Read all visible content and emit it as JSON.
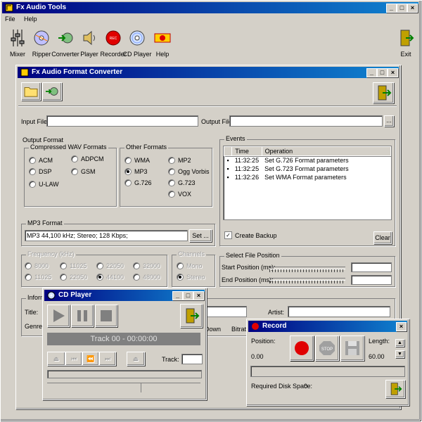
{
  "main_window": {
    "title": "Fx Audio Tools",
    "menu": [
      "File",
      "Help"
    ],
    "toolbar": [
      {
        "label": "Mixer",
        "icon": "mixer-icon"
      },
      {
        "label": "Ripper",
        "icon": "cd-ripper-icon"
      },
      {
        "label": "Converter",
        "icon": "converter-icon"
      },
      {
        "label": "Player",
        "icon": "speaker-icon"
      },
      {
        "label": "Recorder",
        "icon": "record-icon"
      },
      {
        "label": "CD Player",
        "icon": "cd-player-icon"
      },
      {
        "label": "Help",
        "icon": "help-icon"
      }
    ],
    "exit_label": "Exit"
  },
  "converter": {
    "title": "Fx Audio Format Converter",
    "input_file_label": "Input File",
    "input_file_value": "",
    "output_file_label": "Output File",
    "output_file_value": "",
    "browse_label": "...",
    "output_format_label": "Output Format",
    "compressed_label": "Compressed WAV Formats",
    "compressed": [
      "ACM",
      "ADPCM",
      "DSP",
      "GSM",
      "U-LAW"
    ],
    "other_label": "Other Formats",
    "other": [
      "WMA",
      "MP2",
      "MP3",
      "Ogg Vorbis",
      "G.726",
      "G.723",
      "VOX"
    ],
    "other_selected": "MP3",
    "mp3_format_label": "MP3 Format",
    "mp3_format_value": "MP3 44,100 kHz; Stereo; 128 Kbps;",
    "set_label": "Set ...",
    "events_label": "Events",
    "events_columns": [
      "Time",
      "Operation"
    ],
    "events": [
      {
        "time": "11:32:25",
        "op": "Set G.726 Format parameters"
      },
      {
        "time": "11:32:25",
        "op": "Set G.723 Format parameters"
      },
      {
        "time": "11:32:26",
        "op": "Set WMA Format parameters"
      }
    ],
    "create_backup_label": "Create Backup",
    "create_backup_checked": true,
    "clear_label": "Clear",
    "frequency_label": "Frequency (kHz)",
    "frequencies": [
      "8000",
      "11025",
      "22050",
      "32000",
      "44100",
      "48000"
    ],
    "frequencies_row1": [
      "8000",
      "11025",
      "22050",
      "32000"
    ],
    "frequencies_row2": [
      "11025",
      "22050",
      "44100",
      "48000"
    ],
    "channels_label": "Channels",
    "channels": [
      "Mono",
      "Stereo"
    ],
    "select_position_label": "Select File Position",
    "start_position_label": "Start Position (ms):",
    "end_position_label": "End Position (ms):",
    "info_label": "Information",
    "title_label": "Title:",
    "genre_label": "Genre:",
    "artist_label": "Artist:",
    "down_label": "Down",
    "bitrate_label": "Bitrate"
  },
  "cd_player": {
    "title": "CD Player",
    "display": "Track 00 - 00:00:00",
    "track_label": "Track:",
    "track_value": ""
  },
  "record": {
    "title": "Record",
    "position_label": "Position:",
    "position_value": "0.00",
    "length_label": "Length:",
    "length_value": "60.00",
    "disk_space_label": "Required Disk Space:",
    "disk_space_value": "0",
    "stop_label": "STOP"
  }
}
